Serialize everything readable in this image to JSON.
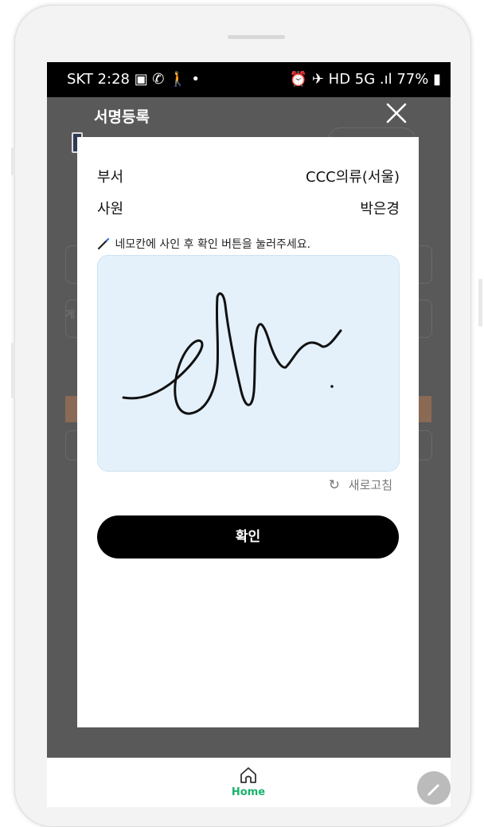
{
  "status_bar": {
    "left": "SKT 2:28 ▣ ✆ 🚶 •",
    "right": "⏰ ✈ HD 5G .ıl 77% ▮"
  },
  "background_page": {
    "title": "서명등록",
    "close_icon": "close-icon",
    "partial_label": "게"
  },
  "modal": {
    "department_label": "부서",
    "department_value": "CCC의류(서울)",
    "employee_label": "사원",
    "employee_value": "박은경",
    "hint": "네모칸에 사인 후 확인 버튼을 눌러주세요.",
    "refresh_label": "새로고침",
    "confirm_label": "확인"
  },
  "bottom_nav": {
    "home_label": "Home",
    "accent_color": "#19b26b"
  },
  "colors": {
    "signature_bg": "#e4f1fb",
    "confirm_bg": "#000000"
  }
}
